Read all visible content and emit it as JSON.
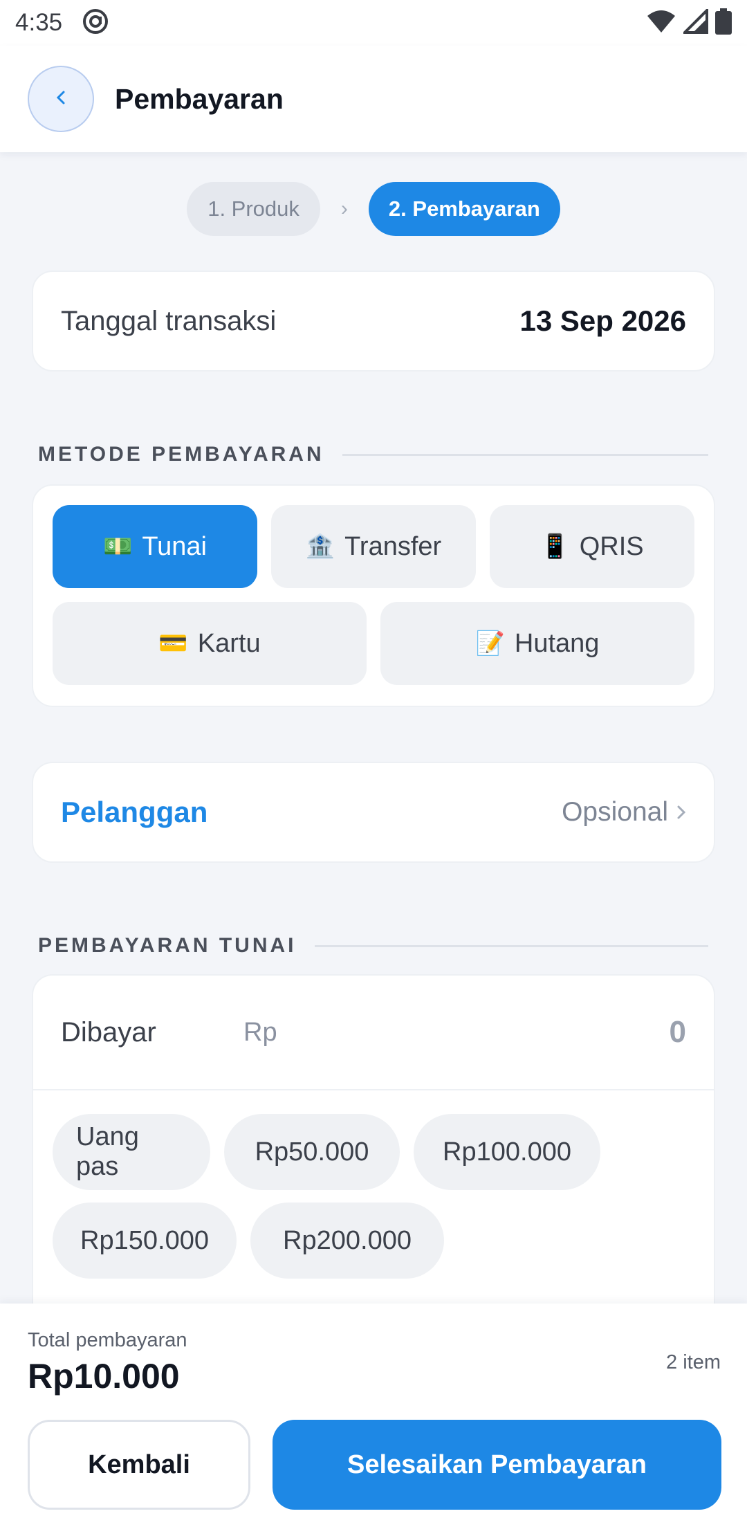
{
  "status_bar": {
    "time": "4:35"
  },
  "header": {
    "title": "Pembayaran"
  },
  "steps": [
    {
      "label": "1. Produk",
      "active": false
    },
    {
      "label": "2. Pembayaran",
      "active": true
    }
  ],
  "transaction": {
    "label": "Tanggal transaksi",
    "date": "13 Sep 2026"
  },
  "payment_methods": {
    "section_title": "METODE PEMBAYARAN",
    "items": [
      {
        "icon": "💵",
        "label": "Tunai",
        "active": true
      },
      {
        "icon": "🏦",
        "label": "Transfer",
        "active": false
      },
      {
        "icon": "📱",
        "label": "QRIS",
        "active": false
      },
      {
        "icon": "💳",
        "label": "Kartu",
        "active": false
      },
      {
        "icon": "📝",
        "label": "Hutang",
        "active": false
      }
    ]
  },
  "customer": {
    "label": "Pelanggan",
    "hint": "Opsional"
  },
  "cash_payment": {
    "section_title": "PEMBAYARAN TUNAI",
    "paid_label": "Dibayar",
    "currency": "Rp",
    "paid_value": "0",
    "quick_amounts": [
      "Uang pas",
      "Rp50.000",
      "Rp100.000",
      "Rp150.000",
      "Rp200.000"
    ]
  },
  "footer": {
    "total_label": "Total pembayaran",
    "total_value": "Rp10.000",
    "item_count": "2 item",
    "back_label": "Kembali",
    "finish_label": "Selesaikan Pembayaran"
  },
  "colors": {
    "accent": "#1e88e5",
    "background": "#f3f5f9"
  }
}
